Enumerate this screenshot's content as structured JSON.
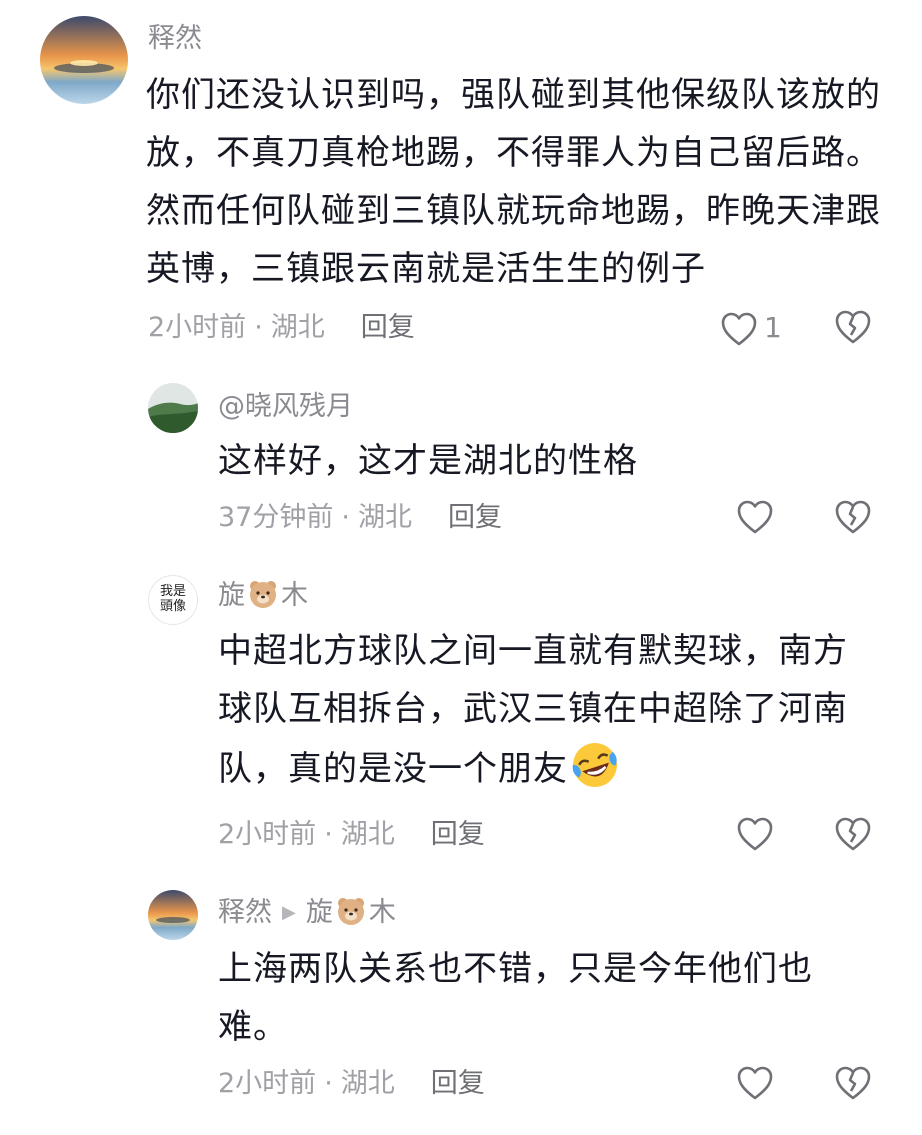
{
  "comments": [
    {
      "user": "释然",
      "text": "你们还没认识到吗，强队碰到其他保级队该放的放，不真刀真枪地踢，不得罪人为自己留后路。然而任何队碰到三镇队就玩命地踢，昨晚天津跟英博，三镇跟云南就是活生生的例子",
      "time": "2小时前",
      "location": "湖北",
      "reply": "回复",
      "likes": "1"
    },
    {
      "user": "@晓风残月",
      "text": "这样好，这才是湖北的性格",
      "time": "37分钟前",
      "location": "湖北",
      "reply": "回复"
    },
    {
      "user_prefix": "旋",
      "user_suffix": "木",
      "avatar_text": "我是頭像",
      "text": "中超北方球队之间一直就有默契球，南方球队互相拆台，武汉三镇在中超除了河南队，真的是没一个朋友",
      "time": "2小时前",
      "location": "湖北",
      "reply": "回复"
    },
    {
      "user": "释然",
      "reply_to_prefix": "旋",
      "reply_to_suffix": "木",
      "text": "上海两队关系也不错，只是今年他们也难。",
      "time": "2小时前",
      "location": "湖北",
      "reply": "回复"
    }
  ],
  "icons": {
    "like": "heart-outline-icon",
    "dislike": "broken-heart-icon",
    "emoji": "laughing-crying-emoji",
    "badge": "bear-face-emoji",
    "reply_arrow": "play-arrow-icon"
  },
  "colors": {
    "text": "#161823",
    "name": "#8a8b91",
    "meta": "#a0a1a6"
  }
}
